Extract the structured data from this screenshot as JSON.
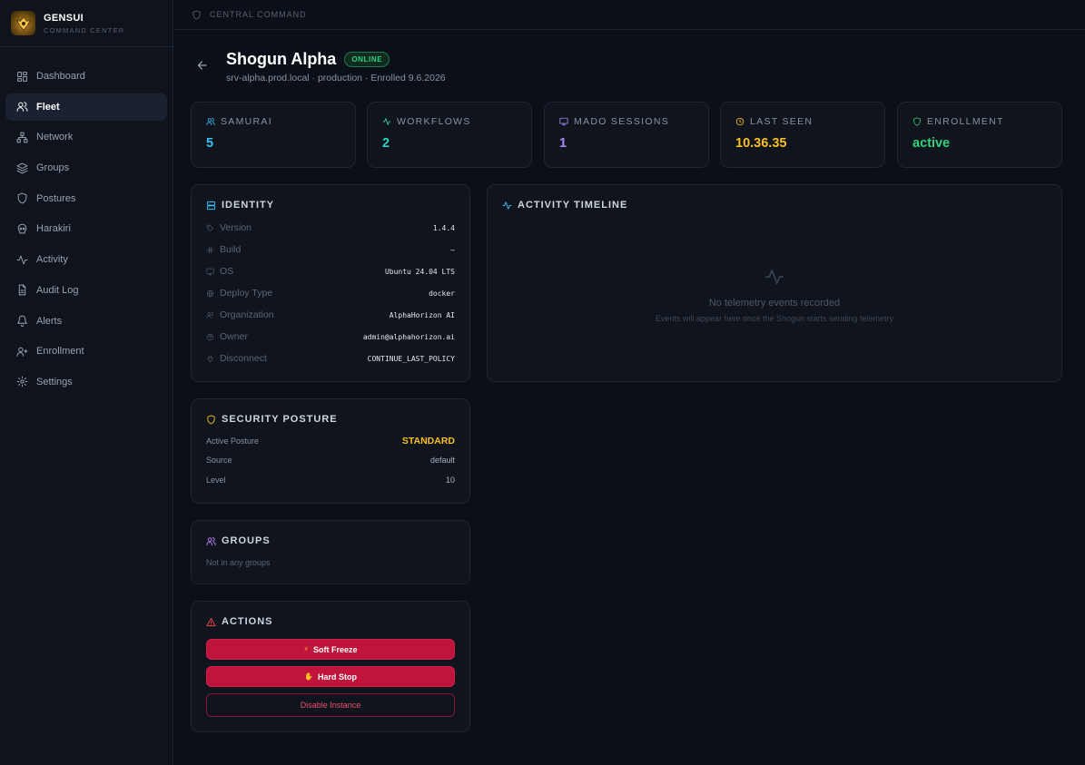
{
  "brand": {
    "name": "GENSUI",
    "subtitle": "COMMAND CENTER"
  },
  "nav": [
    {
      "label": "Dashboard",
      "icon": "dashboard-icon",
      "active": false
    },
    {
      "label": "Fleet",
      "icon": "users-icon",
      "active": true
    },
    {
      "label": "Network",
      "icon": "network-icon",
      "active": false
    },
    {
      "label": "Groups",
      "icon": "layers-icon",
      "active": false
    },
    {
      "label": "Postures",
      "icon": "shield-icon",
      "active": false
    },
    {
      "label": "Harakiri",
      "icon": "skull-icon",
      "active": false
    },
    {
      "label": "Activity",
      "icon": "activity-icon",
      "active": false
    },
    {
      "label": "Audit Log",
      "icon": "file-icon",
      "active": false
    },
    {
      "label": "Alerts",
      "icon": "bell-icon",
      "active": false
    },
    {
      "label": "Enrollment",
      "icon": "user-plus-icon",
      "active": false
    },
    {
      "label": "Settings",
      "icon": "gear-icon",
      "active": false
    }
  ],
  "breadcrumb": "CENTRAL COMMAND",
  "header": {
    "title": "Shogun Alpha",
    "status": "ONLINE",
    "subtitle": "srv-alpha.prod.local · production · Enrolled 9.6.2026"
  },
  "stats": [
    {
      "label": "SAMURAI",
      "value": "5",
      "color": "#38bdf8"
    },
    {
      "label": "WORKFLOWS",
      "value": "2",
      "color": "#2dd4bf"
    },
    {
      "label": "MADO SESSIONS",
      "value": "1",
      "color": "#a78bfa"
    },
    {
      "label": "LAST SEEN",
      "value": "10.36.35",
      "color": "#fbbf24"
    },
    {
      "label": "ENROLLMENT",
      "value": "active",
      "color": "#34d07c"
    }
  ],
  "identity": {
    "title": "IDENTITY",
    "rows": [
      {
        "key": "Version",
        "value": "1.4.4"
      },
      {
        "key": "Build",
        "value": "—"
      },
      {
        "key": "OS",
        "value": "Ubuntu 24.04 LTS"
      },
      {
        "key": "Deploy Type",
        "value": "docker"
      },
      {
        "key": "Organization",
        "value": "AlphaHorizon AI"
      },
      {
        "key": "Owner",
        "value": "admin@alphahorizon.ai"
      },
      {
        "key": "Disconnect",
        "value": "CONTINUE_LAST_POLICY"
      }
    ]
  },
  "posture": {
    "title": "SECURITY POSTURE",
    "active_label": "Active Posture",
    "active_value": "STANDARD",
    "source_label": "Source",
    "source_value": "default",
    "level_label": "Level",
    "level_value": "10"
  },
  "groups": {
    "title": "GROUPS",
    "empty": "Not in any groups"
  },
  "actions": {
    "title": "ACTIONS",
    "soft_freeze": "Soft Freeze",
    "hard_stop": "Hard Stop",
    "disable": "Disable Instance"
  },
  "timeline": {
    "title": "ACTIVITY TIMELINE",
    "empty_title": "No telemetry events recorded",
    "empty_sub": "Events will appear here once the Shogun starts sending telemetry"
  },
  "colors": {
    "accent_red": "#c0143c",
    "posture_gold": "#fbbf24",
    "online_green": "#34d07c"
  }
}
